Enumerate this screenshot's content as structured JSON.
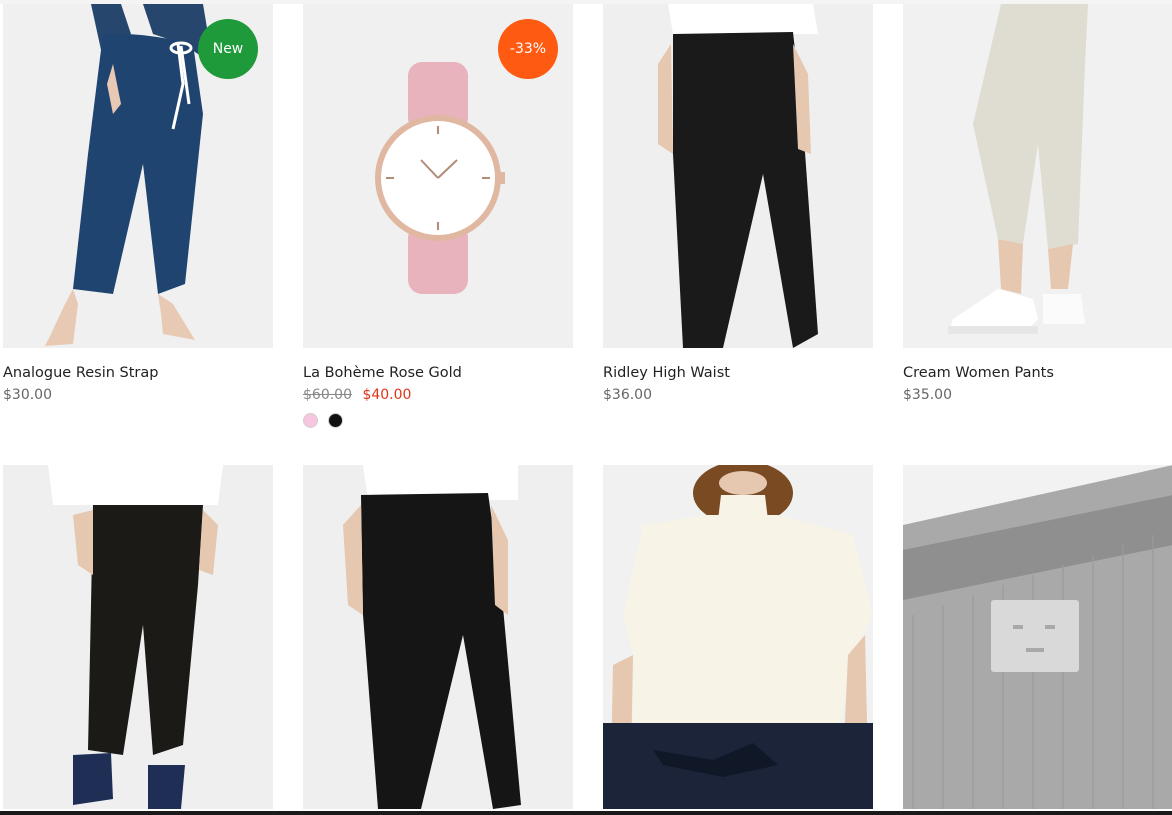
{
  "products": [
    {
      "title": "Analogue Resin Strap",
      "price": "$30.00",
      "badge": "New",
      "badge_color": "#1e9a3a",
      "image": "navy-jogger-pants"
    },
    {
      "title": "La Bohème Rose Gold",
      "price_old": "$60.00",
      "price_sale": "$40.00",
      "badge": "-33%",
      "badge_color": "#ff5a12",
      "swatches": [
        {
          "name": "pink",
          "color": "#f5c6dd"
        },
        {
          "name": "black",
          "color": "#111111"
        }
      ],
      "image": "rose-watch"
    },
    {
      "title": "Ridley High Waist",
      "price": "$36.00",
      "image": "black-trousers"
    },
    {
      "title": "Cream Women Pants",
      "price": "$35.00",
      "image": "cream-joggers"
    },
    {
      "image": "black-cargo-pants"
    },
    {
      "image": "black-trousers-2"
    },
    {
      "image": "cream-knit-top"
    },
    {
      "image": "grey-beanie"
    }
  ],
  "colors": {
    "sale": "#e0341a",
    "title": "#222222",
    "price": "#666666"
  }
}
